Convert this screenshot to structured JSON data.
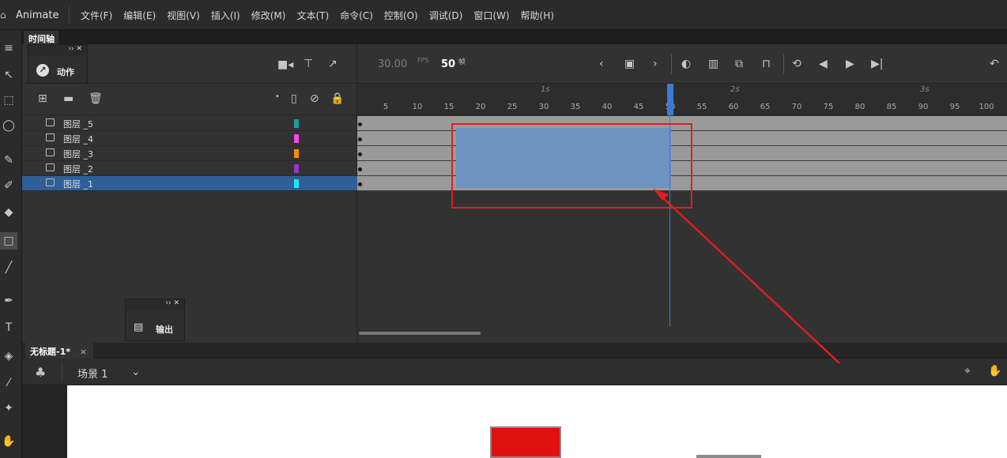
{
  "menubar": {
    "app_name": "Animate",
    "items": [
      "文件(F)",
      "编辑(E)",
      "视图(V)",
      "插入(I)",
      "修改(M)",
      "文本(T)",
      "命令(C)",
      "控制(O)",
      "调试(D)",
      "窗口(W)",
      "帮助(H)"
    ]
  },
  "timeline": {
    "tab_label": "时间轴",
    "fps": "30.00",
    "fps_unit": "FPS",
    "current_frame": "50",
    "frame_unit": "帧",
    "seconds": [
      "1s",
      "2s",
      "3s"
    ],
    "frame_numbers": [
      "5",
      "10",
      "15",
      "20",
      "25",
      "30",
      "35",
      "40",
      "45",
      "50",
      "55",
      "60",
      "65",
      "70",
      "75",
      "80",
      "85",
      "90",
      "95",
      "100"
    ],
    "layers": [
      {
        "name": "图层 _5",
        "color": "#1a9e9e",
        "selected": false
      },
      {
        "name": "图层 _4",
        "color": "#ff44ee",
        "selected": false
      },
      {
        "name": "图层 _3",
        "color": "#ff8a00",
        "selected": false
      },
      {
        "name": "图层 _2",
        "color": "#9933cc",
        "selected": false
      },
      {
        "name": "图层 _1",
        "color": "#22e6f0",
        "selected": true
      }
    ]
  },
  "panels": {
    "actions_label": "动作",
    "output_label": "输出"
  },
  "document": {
    "tab_title": "无标题-1*",
    "scene_label": "场景 1"
  },
  "colors": {
    "selection": "#6f93c0",
    "playhead": "#3a7bd5",
    "annotation": "#e21d1d",
    "stage_red": "#e01010"
  }
}
